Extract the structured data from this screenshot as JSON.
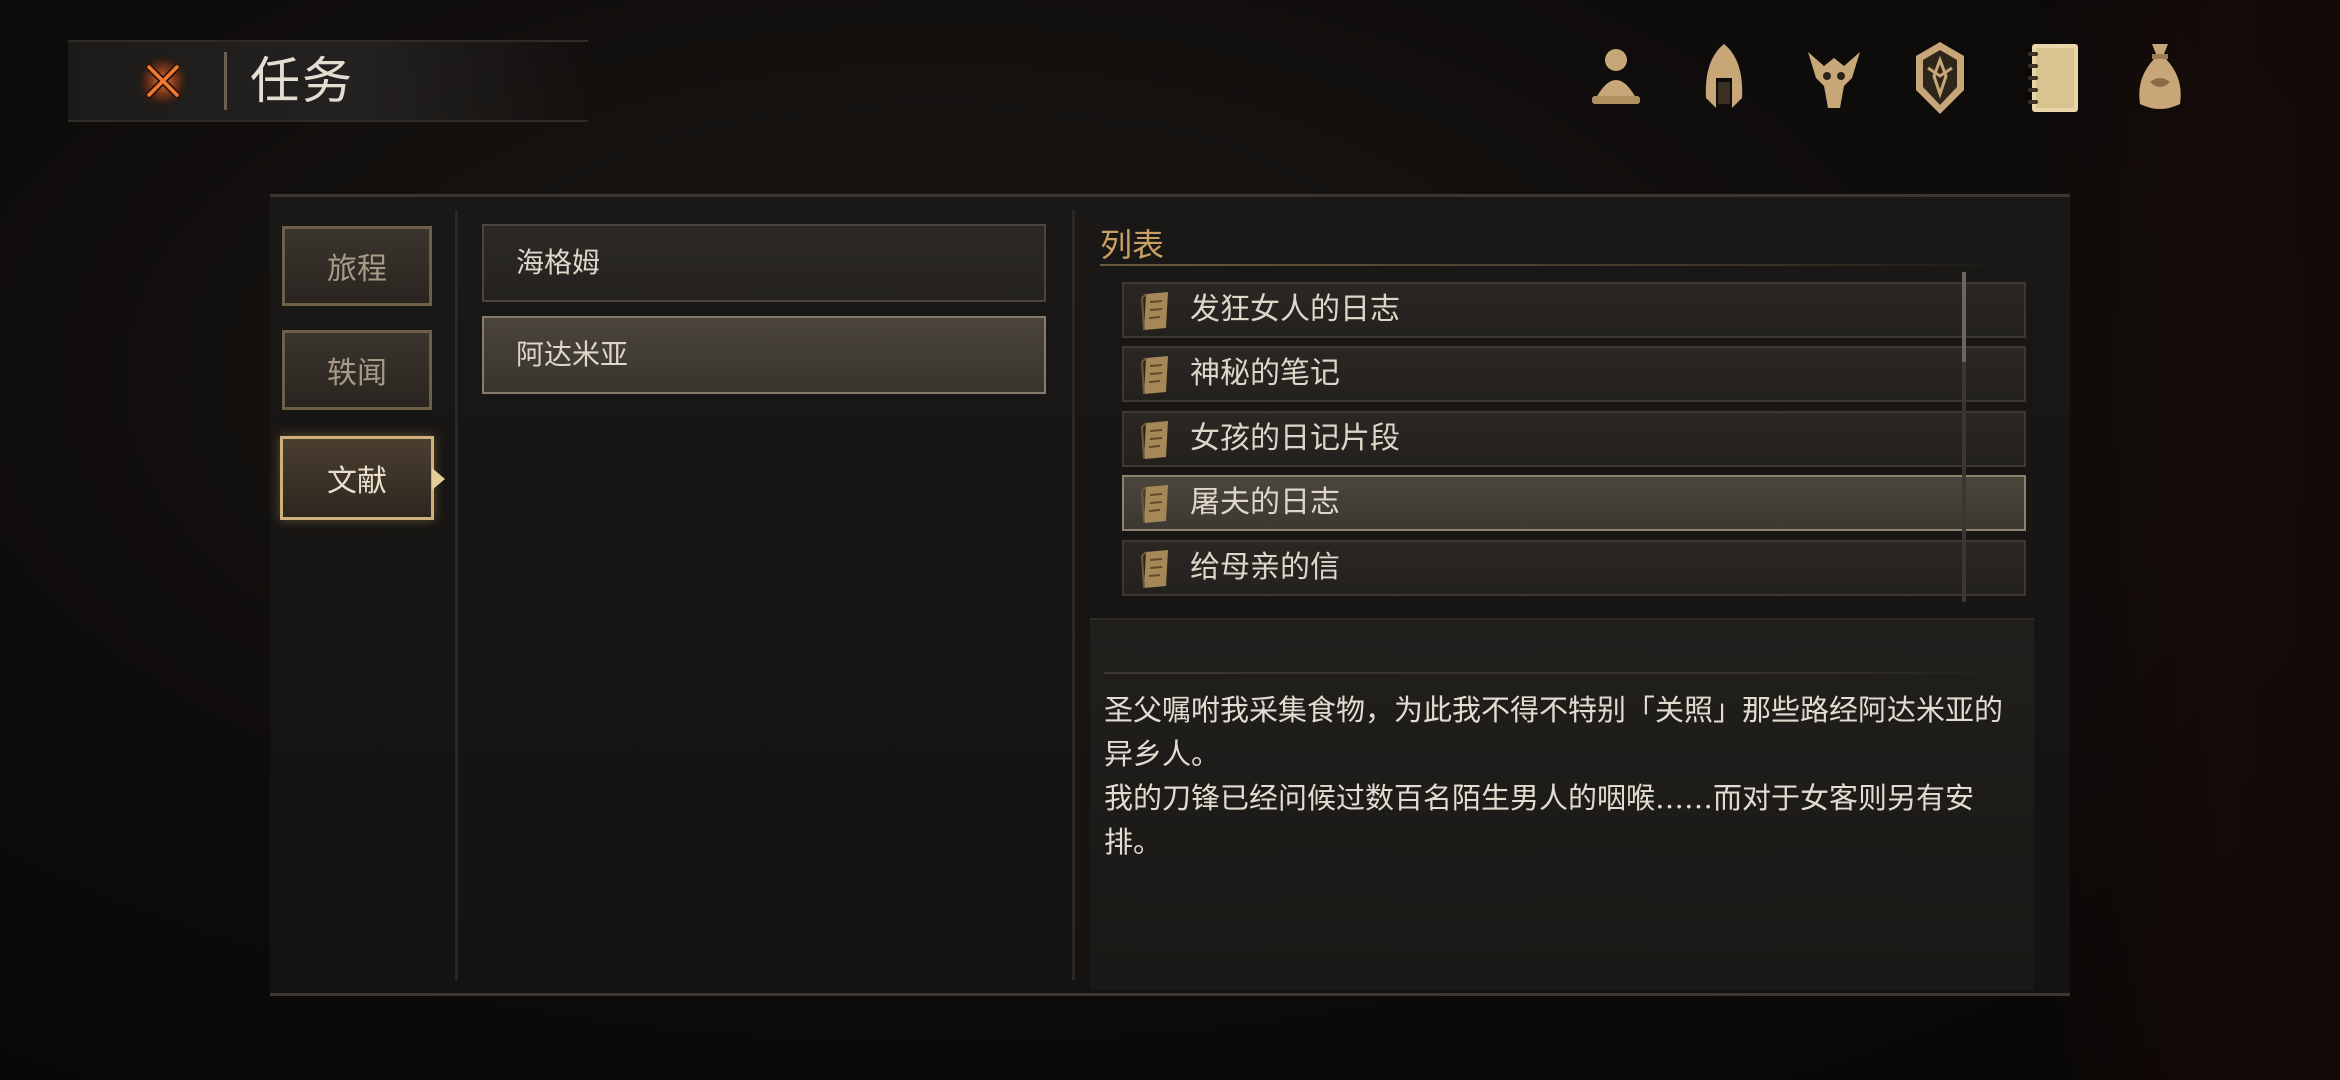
{
  "header": {
    "title": "任务",
    "close_icon": "close-x-icon"
  },
  "top_nav": [
    {
      "name": "character-icon"
    },
    {
      "name": "helmet-icon"
    },
    {
      "name": "beast-skull-icon"
    },
    {
      "name": "crest-shield-icon"
    },
    {
      "name": "journal-icon"
    },
    {
      "name": "loot-bag-icon"
    }
  ],
  "categories": [
    {
      "label": "旅程",
      "active": false
    },
    {
      "label": "轶闻",
      "active": false
    },
    {
      "label": "文献",
      "active": true
    }
  ],
  "locations": [
    {
      "label": "海格姆",
      "selected": false
    },
    {
      "label": "阿达米亚",
      "selected": true
    }
  ],
  "list": {
    "header": "列表",
    "items": [
      {
        "label": "发狂女人的日志",
        "selected": false
      },
      {
        "label": "神秘的笔记",
        "selected": false
      },
      {
        "label": "女孩的日记片段",
        "selected": false
      },
      {
        "label": "屠夫的日志",
        "selected": true
      },
      {
        "label": "给母亲的信",
        "selected": false
      }
    ]
  },
  "detail": {
    "text": "圣父嘱咐我采集食物，为此我不得不特别「关照」那些路经阿达米亚的异乡人。\n我的刀锋已经问候过数百名陌生男人的咽喉……而对于女客则另有安排。"
  },
  "colors": {
    "accent_gold": "#c8a063",
    "icon_gold": "#c7a678",
    "close_orange": "#e2622a"
  }
}
